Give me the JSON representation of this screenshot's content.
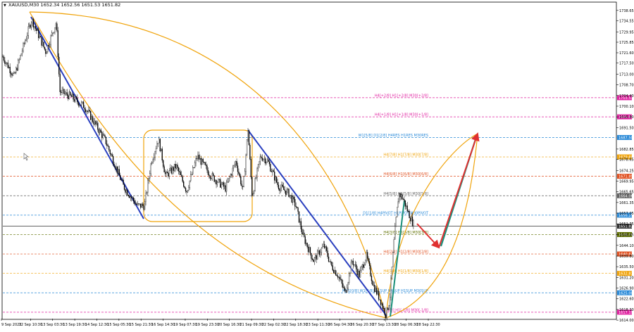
{
  "header": {
    "marker": "▼",
    "text": "XAUUSD,M30 1652.34 1652.56 1651.53 1651.82"
  },
  "colors": {
    "candle": "#000000",
    "trendline": "#2a3fbf",
    "arc": "#f0a30a",
    "arrow_up": "#1a8f7a",
    "arrow_down": "#e03030",
    "grid_bg": "#ffffff",
    "axis": "#000000"
  },
  "chart_data": {
    "type": "candlestick",
    "title": "XAUUSD,M30",
    "ohlc_last": {
      "open": 1652.34,
      "high": 1652.56,
      "low": 1651.53,
      "close": 1651.82
    },
    "ylim": [
      1614.6,
      1741.7
    ],
    "y_ticks": [
      1738.65,
      1734.55,
      1729.95,
      1725.85,
      1721.6,
      1717.5,
      1713.0,
      1708.7,
      1704.4,
      1700.1,
      1695.8,
      1691.5,
      1682.85,
      1678.65,
      1674.25,
      1669.95,
      1665.65,
      1661.35,
      1657.05,
      1652.75,
      1648.45,
      1644.1,
      1639.8,
      1635.5,
      1631.2,
      1626.9,
      1622.6,
      1618.3,
      1614.0
    ],
    "x_ticks": [
      "9 Sep 2022",
      "12 Sep 10:30",
      "13 Sep 03:30",
      "13 Sep 19:30",
      "14 Sep 12:30",
      "15 Sep 05:30",
      "15 Sep 21:30",
      "16 Sep 14:30",
      "19 Sep 07:30",
      "19 Sep 23:30",
      "20 Sep 16:30",
      "21 Sep 09:30",
      "22 Sep 02:30",
      "22 Sep 18:30",
      "23 Sep 11:30",
      "26 Sep 04:30",
      "26 Sep 20:30",
      "27 Sep 13:30",
      "28 Sep 06:30",
      "28 Sep 22:30"
    ],
    "price_path": [
      [
        0,
        1722
      ],
      [
        20,
        1712
      ],
      [
        45,
        1735
      ],
      [
        65,
        1722
      ],
      [
        80,
        1734
      ],
      [
        85,
        1706
      ],
      [
        100,
        1704
      ],
      [
        120,
        1700
      ],
      [
        150,
        1686
      ],
      [
        175,
        1668
      ],
      [
        195,
        1660
      ],
      [
        205,
        1660
      ],
      [
        215,
        1678
      ],
      [
        225,
        1687
      ],
      [
        235,
        1672
      ],
      [
        250,
        1676
      ],
      [
        265,
        1666
      ],
      [
        280,
        1680
      ],
      [
        300,
        1672
      ],
      [
        320,
        1667
      ],
      [
        335,
        1678
      ],
      [
        345,
        1666
      ],
      [
        352,
        1691
      ],
      [
        358,
        1664
      ],
      [
        370,
        1680
      ],
      [
        380,
        1678
      ],
      [
        395,
        1668
      ],
      [
        410,
        1665
      ],
      [
        420,
        1660
      ],
      [
        430,
        1648
      ],
      [
        445,
        1638
      ],
      [
        460,
        1644
      ],
      [
        470,
        1636
      ],
      [
        480,
        1632
      ],
      [
        490,
        1625
      ],
      [
        500,
        1638
      ],
      [
        510,
        1632
      ],
      [
        520,
        1640
      ],
      [
        530,
        1628
      ],
      [
        540,
        1622
      ],
      [
        548,
        1616
      ],
      [
        553,
        1622
      ],
      [
        560,
        1648
      ],
      [
        566,
        1665
      ],
      [
        572,
        1663
      ],
      [
        580,
        1657
      ],
      [
        588,
        1652
      ]
    ],
    "hlines": [
      {
        "label": "H4[+2/8] H1[+2/8] M30[+2/8]",
        "value": 1703.51,
        "color": "#e020a0"
      },
      {
        "label": "H4[+1/8] H1[+1/8] M30[+1/8]",
        "value": 1695.81,
        "color": "#e020a0"
      },
      {
        "label": "W1[5/8] D1[2/8] H4RES H1RES M30RES",
        "value": 1687.5,
        "color": "#2a8ad8"
      },
      {
        "label": "H4[7/8] H1[7/8] M30[7/8]",
        "value": 1679.69,
        "color": "#f0a30a"
      },
      {
        "label": "H4[6/8] H1[6/8] M30[6/8]",
        "value": 1671.89,
        "color": "#e05020"
      },
      {
        "label": "H4[5/8] H1[5/8] M30[5/8]",
        "value": 1664.06,
        "color": "#606060"
      },
      {
        "label": "D1[1/8] H4PIVOT H1PIVOT M30PIVOT",
        "value": 1656.25,
        "color": "#2a8ad8"
      },
      {
        "label": "",
        "value": 1651.82,
        "color": "#303030"
      },
      {
        "label": "H4[3/8] H1[3/8] M30[3/8]",
        "value": 1648.44,
        "color": "#607000"
      },
      {
        "label": "H4[2/8] H1[2/8] M30[2/8]",
        "value": 1640.62,
        "color": "#e05020"
      },
      {
        "label": "H4[1/8] H1[1/8] M30[1/8]",
        "value": 1632.81,
        "color": "#f0a30a"
      },
      {
        "label": "MN1[0/8] W1[4/8] D1SUP H4SUP H1SUP M30SUP",
        "value": 1625.0,
        "color": "#2a8ad8"
      },
      {
        "label": "H4[-1/8] H1[-1/8] M30[-1/8]",
        "value": 1617.19,
        "color": "#e020a0"
      }
    ]
  }
}
